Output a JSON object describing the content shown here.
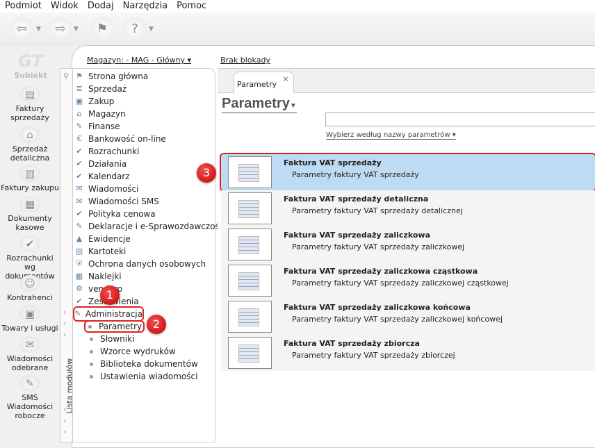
{
  "menu": [
    "Podmiot",
    "Widok",
    "Dodaj",
    "Narzędzia",
    "Pomoc"
  ],
  "toolbar": {
    "icons": [
      "back-arrow-icon",
      "forward-arrow-icon",
      "flag-icon",
      "help-icon"
    ]
  },
  "logo": {
    "text": "Subiekt"
  },
  "leftbar": [
    {
      "label": "Faktury sprzedaży",
      "icon": "coins-icon"
    },
    {
      "label": "Sprzedaż detaliczna",
      "icon": "basket-icon"
    },
    {
      "label": "Faktury zakupu",
      "icon": "books-icon"
    },
    {
      "label": "Dokumenty kasowe",
      "icon": "cash-register-icon"
    },
    {
      "label": "Rozrachunki wg dokumentów",
      "icon": "checked-docs-icon"
    },
    {
      "label": "Kontrahenci",
      "icon": "person-icon"
    },
    {
      "label": "Towary i usługi",
      "icon": "box-icon"
    },
    {
      "label": "Wiadomości odebrane",
      "icon": "inbox-icon"
    },
    {
      "label": "SMS Wiadomości robocze",
      "icon": "sms-icon"
    }
  ],
  "topbar": {
    "magazyn": "Magazyn: - MAG - Główny ▾",
    "blokada": "Brak blokady"
  },
  "modules": {
    "strip_label": "Lista modułów",
    "items": [
      "Strona główna",
      "Sprzedaż",
      "Zakup",
      "Magazyn",
      "Finanse",
      "Bankowość on-line",
      "Rozrachunki",
      "Działania",
      "Kalendarz",
      "Wiadomości",
      "Wiadomości SMS",
      "Polityka cenowa",
      "Deklaracje i e-Sprawozdawczość",
      "Ewidencje",
      "Kartoteki",
      "Ochrona danych osobowych",
      "Naklejki",
      "vendero",
      "Zestawienia",
      "Administracja"
    ],
    "subitems": [
      "Parametry",
      "Słowniki",
      "Wzorce wydruków",
      "Biblioteka dokumentów",
      "Ustawienia wiadomości"
    ]
  },
  "tab": {
    "label": "Parametry",
    "close": "✕"
  },
  "page": {
    "title": "Parametry",
    "search_value": "",
    "filter": "Wybierz według nazwy parametrów"
  },
  "params": [
    {
      "title": "Faktura VAT sprzedaży",
      "desc": "Parametry faktury VAT sprzedaży",
      "selected": true
    },
    {
      "title": "Faktura VAT sprzedaży detaliczna",
      "desc": "Parametry faktury VAT sprzedaży detalicznej"
    },
    {
      "title": "Faktura VAT sprzedaży zaliczkowa",
      "desc": "Parametry faktury VAT sprzedaży zaliczkowej"
    },
    {
      "title": "Faktura VAT sprzedaży zaliczkowa cząstkowa",
      "desc": "Parametry faktury VAT sprzedaży zaliczkowej cząstkowej"
    },
    {
      "title": "Faktura VAT sprzedaży zaliczkowa końcowa",
      "desc": "Parametry faktury VAT sprzedaży zaliczkowej końcowej"
    },
    {
      "title": "Faktura VAT sprzedaży zbiorcza",
      "desc": "Parametry faktury VAT sprzedaży zbiorczej"
    }
  ],
  "badges": [
    "1",
    "2",
    "3"
  ],
  "colors": {
    "highlight": "#e02020",
    "selected_row": "#bddbf3"
  }
}
